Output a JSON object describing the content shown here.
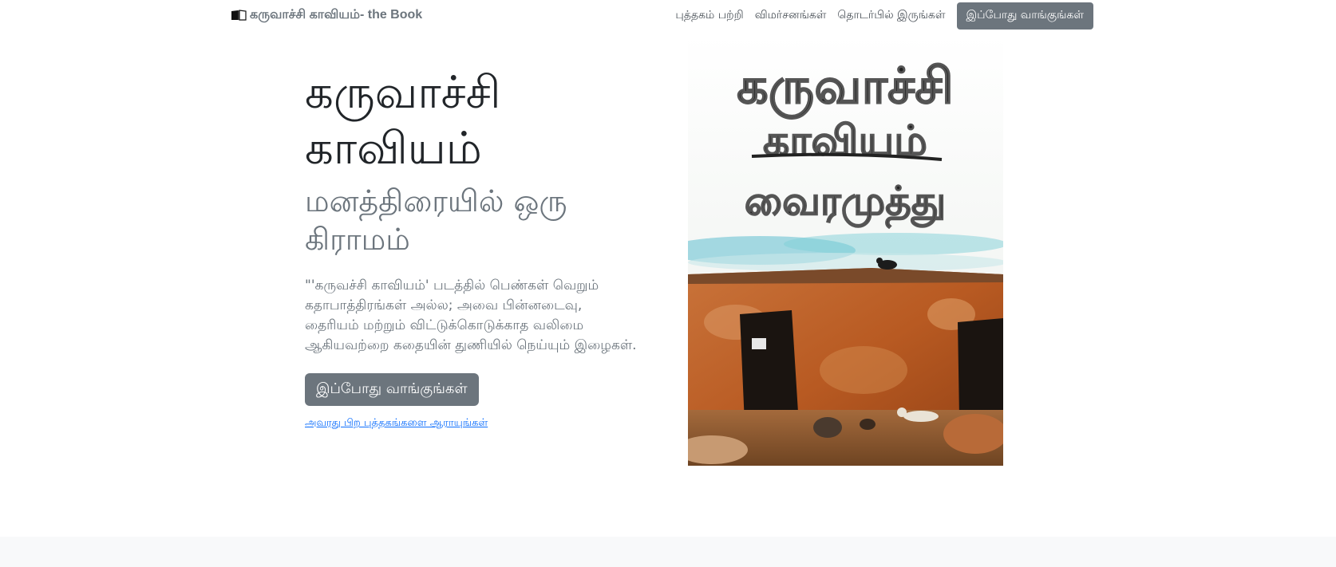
{
  "navbar": {
    "brand_icon": "open-book-icon",
    "brand_text": "கருவாச்சி காவியம்- the Book",
    "links": [
      "புத்தகம் பற்றி",
      "விமர்சனங்கள்",
      "தொடர்பில் இருங்கள்"
    ],
    "buy_label": "இப்போது வாங்குங்கள்"
  },
  "hero": {
    "title": "கருவாச்சி காவியம்",
    "subtitle": "மனத்திரையில் ஒரு கிராமம்",
    "description": "\"'கருவச்சி காவியம்' படத்தில் பெண்கள் வெறும் கதாபாத்திரங்கள் அல்ல; அவை பின்னடைவு, தைரியம் மற்றும் விட்டுக்கொடுக்காத வலிமை ஆகியவற்றை கதையின் துணியில் நெய்யும் இழைகள்.",
    "buy_label": "இப்போது வாங்குங்கள்",
    "more_books_link": "அவரது பிற புத்தகங்களை ஆராயுங்கள்"
  },
  "cover": {
    "title_line1": "கருவாச்சி",
    "title_line2": "காவியம்",
    "author": "வைரமுத்து"
  },
  "colors": {
    "button_gray": "#6c757d",
    "link_blue": "#0d6efd",
    "footer_bg": "#f8f9fa"
  }
}
